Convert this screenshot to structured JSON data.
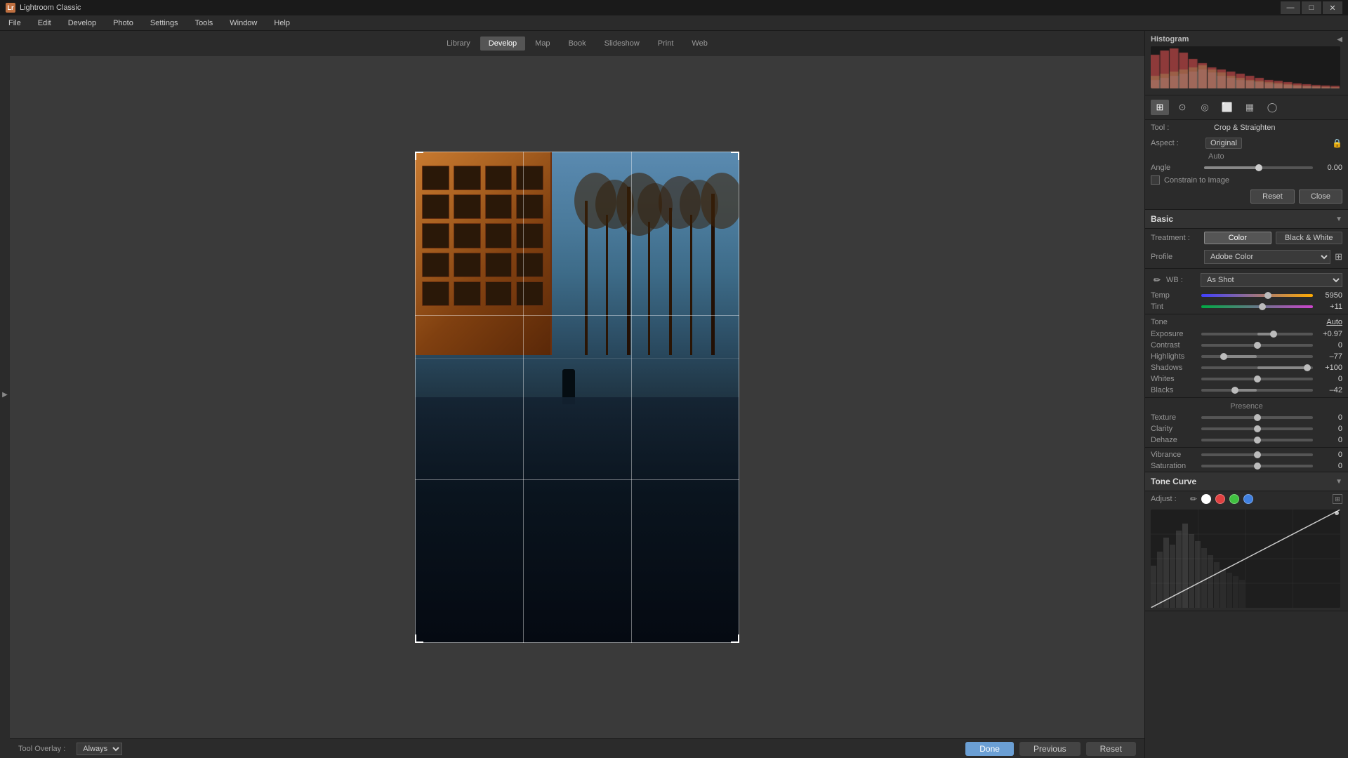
{
  "app": {
    "title": "Lightroom Classic",
    "icon": "Lr"
  },
  "titlebar": {
    "title": "Lightroom Classic",
    "minimize": "—",
    "maximize": "□",
    "close": "✕"
  },
  "menubar": {
    "items": [
      "File",
      "Edit",
      "Develop",
      "Photo",
      "Settings",
      "Tools",
      "Window",
      "Help"
    ]
  },
  "modules": [
    "Library",
    "Develop",
    "Map",
    "Book",
    "Slideshow",
    "Print",
    "Web"
  ],
  "active_module": "Develop",
  "tool_panel": {
    "header": "Tool : Crop & Straighten",
    "tool_label": "Tool :",
    "tool_value": "Crop & Straighten",
    "aspect_label": "Aspect :",
    "aspect_value": "Original",
    "auto_label": "Auto",
    "angle_label": "Angle",
    "angle_value": "0.00",
    "constrain_label": "Constrain to Image",
    "reset_label": "Reset",
    "close_label": "Close"
  },
  "basic_panel": {
    "title": "Basic",
    "treatment_label": "Treatment :",
    "treatment_color": "Color",
    "treatment_bw": "Black & White",
    "profile_label": "Profile",
    "profile_value": "Adobe Color",
    "wb_label": "WB :",
    "wb_value": "As Shot",
    "temp_label": "Temp",
    "temp_value": "5950",
    "tint_label": "Tint",
    "tint_value": "+11",
    "tone_label": "Tone",
    "tone_auto": "Auto",
    "exposure_label": "Exposure",
    "exposure_value": "+0.97",
    "contrast_label": "Contrast",
    "contrast_value": "0",
    "highlights_label": "Highlights",
    "highlights_value": "–77",
    "shadows_label": "Shadows",
    "shadows_value": "+100",
    "whites_label": "Whites",
    "whites_value": "0",
    "blacks_label": "Blacks",
    "blacks_value": "–42",
    "presence_label": "Presence",
    "texture_label": "Texture",
    "texture_value": "0",
    "clarity_label": "Clarity",
    "clarity_value": "0",
    "dehaze_label": "Dehaze",
    "dehaze_value": "0",
    "vibrance_label": "Vibrance",
    "vibrance_value": "0",
    "saturation_label": "Saturation",
    "saturation_value": "0"
  },
  "tone_curve": {
    "title": "Tone Curve",
    "adjust_label": "Adjust :",
    "collapse_icon": "▼"
  },
  "histogram": {
    "title": "Histogram",
    "collapse": "◀"
  },
  "bottom_bar": {
    "tool_overlay_label": "Tool Overlay :",
    "tool_overlay_value": "Always",
    "done_label": "Done",
    "previous_label": "Previous",
    "reset_label": "Reset"
  },
  "sliders": {
    "temp_percent": 60,
    "tint_percent": 55,
    "exposure_percent": 65,
    "contrast_percent": 50,
    "highlights_percent": 20,
    "shadows_percent": 95,
    "whites_percent": 50,
    "blacks_percent": 30,
    "texture_percent": 50,
    "clarity_percent": 50,
    "dehaze_percent": 50,
    "vibrance_percent": 50,
    "saturation_percent": 50
  },
  "colors": {
    "accent": "#6b9fd4",
    "panel_bg": "#2b2b2b",
    "section_bg": "#333",
    "active_treatment": "#555",
    "active_color": "Color"
  }
}
